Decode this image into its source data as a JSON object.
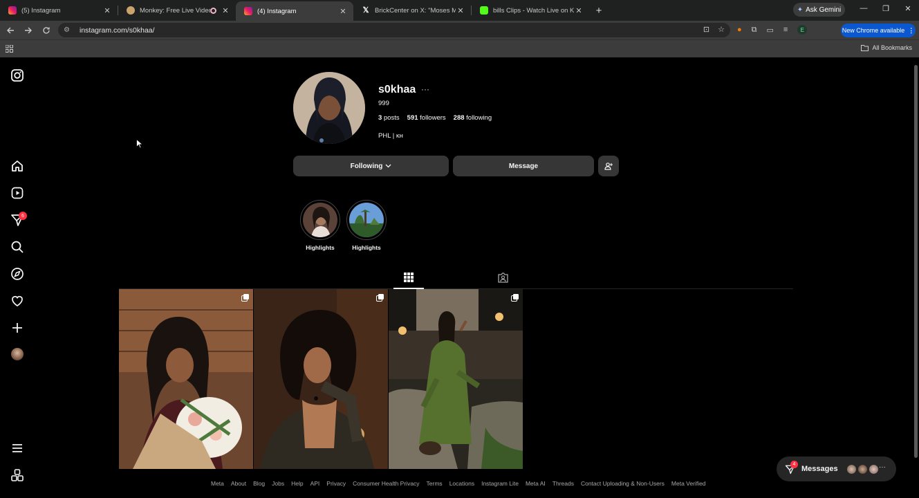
{
  "browser": {
    "tabs": [
      {
        "title": "(5) Instagram",
        "active": false
      },
      {
        "title": "Monkey: Free Live Video Ch",
        "active": false
      },
      {
        "title": "(4) Instagram",
        "active": true
      },
      {
        "title": "BrickCenter on X: \"Moses Moo",
        "active": false
      },
      {
        "title": "bills Clips - Watch Live on Kick",
        "active": false
      }
    ],
    "new_tab": "+",
    "gemini_label": "Ask Gemini",
    "url": "instagram.com/s0khaa/",
    "profile_initial": "E",
    "update_label": "New Chrome available",
    "bookmarks_label": "All Bookmarks",
    "colors": {
      "update_pill": "#0b57d0",
      "active_tab": "#3c3c3c"
    }
  },
  "sidebar": {
    "notification_count": "6",
    "items": [
      "instagram-logo",
      "home",
      "reels",
      "messages",
      "search",
      "explore",
      "notifications",
      "create",
      "profile",
      "more",
      "also-from-meta"
    ]
  },
  "profile": {
    "username": "s0khaa",
    "more": "···",
    "full_name": "999",
    "posts_count": "3",
    "posts_label": "posts",
    "followers_count": "591",
    "followers_label": "followers",
    "following_count": "288",
    "following_label": "following",
    "bio": "PHL | ĸн",
    "following_button": "Following",
    "message_button": "Message",
    "highlights": [
      {
        "label": "Highlights"
      },
      {
        "label": "Highlights"
      }
    ]
  },
  "footer": {
    "links": [
      "Meta",
      "About",
      "Blog",
      "Jobs",
      "Help",
      "API",
      "Privacy",
      "Consumer Health Privacy",
      "Terms",
      "Locations",
      "Instagram Lite",
      "Meta AI",
      "Threads",
      "Contact Uploading & Non-Users",
      "Meta Verified"
    ]
  },
  "messages_widget": {
    "label": "Messages",
    "count": "4",
    "more": "···"
  }
}
